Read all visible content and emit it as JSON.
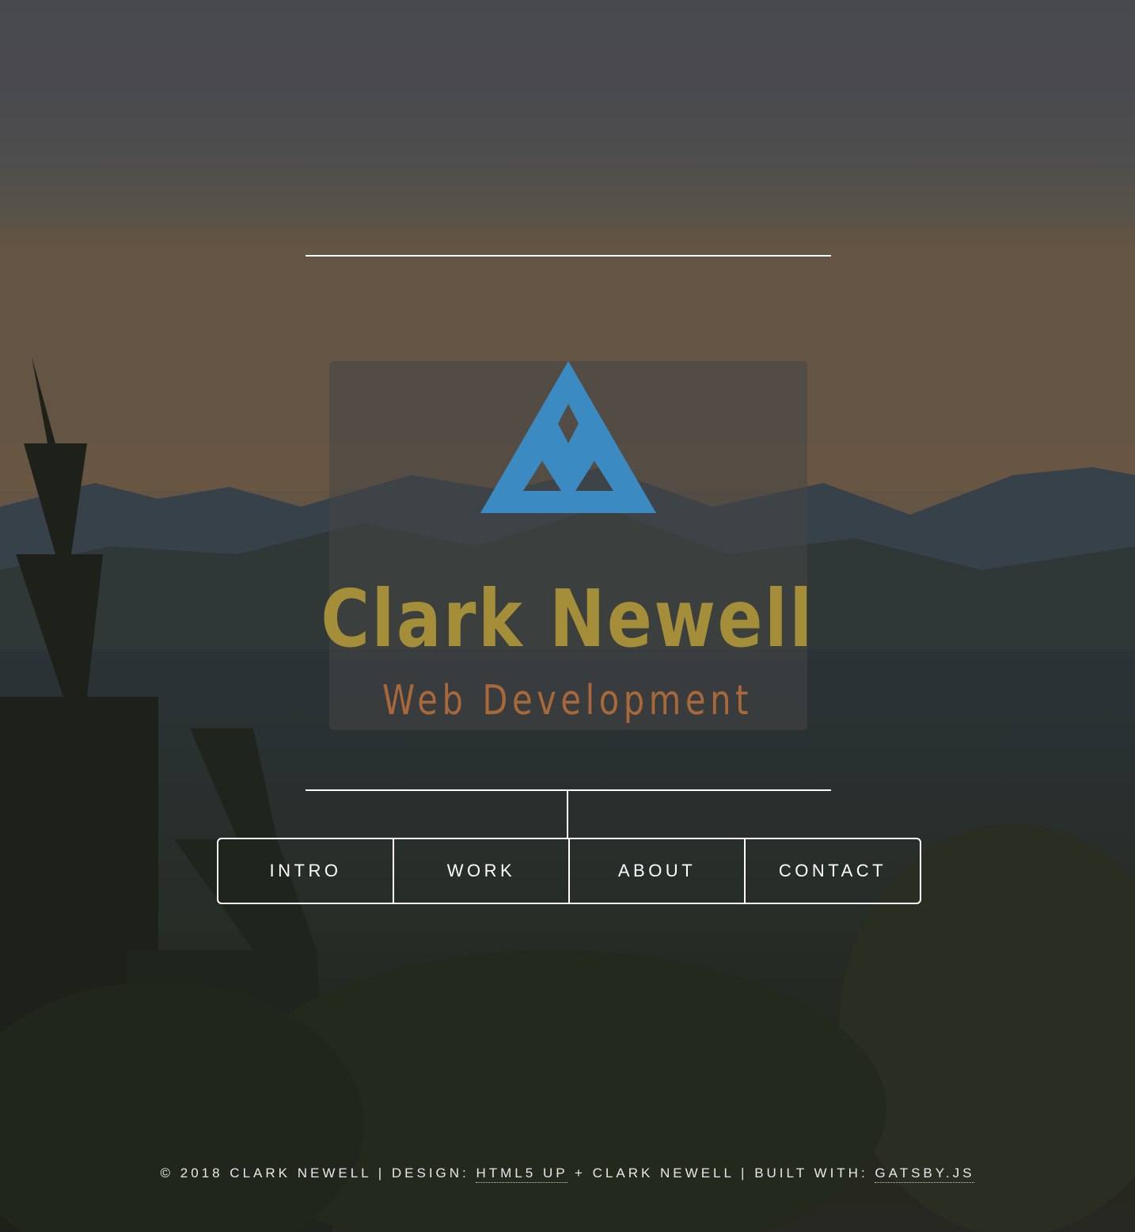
{
  "colors": {
    "logo_blue": "#3b8ac1",
    "title_gold": "#a58e3a",
    "subtitle_copper": "#a8683a",
    "line_white": "#ffffff"
  },
  "header": {
    "logo_icon": "mountain-triangle-logo",
    "title": "Clark Newell",
    "subtitle": "Web Development"
  },
  "nav": {
    "items": [
      {
        "label": "INTRO"
      },
      {
        "label": "WORK"
      },
      {
        "label": "ABOUT"
      },
      {
        "label": "CONTACT"
      }
    ]
  },
  "footer": {
    "copyright": "© 2018 CLARK NEWELL",
    "separator": " | ",
    "design_prefix": "DESIGN: ",
    "design_link": "HTML5 UP",
    "design_joiner": " + ",
    "design_author": "CLARK NEWELL",
    "built_prefix": "BUILT WITH: ",
    "built_link": "GATSBY.JS"
  }
}
